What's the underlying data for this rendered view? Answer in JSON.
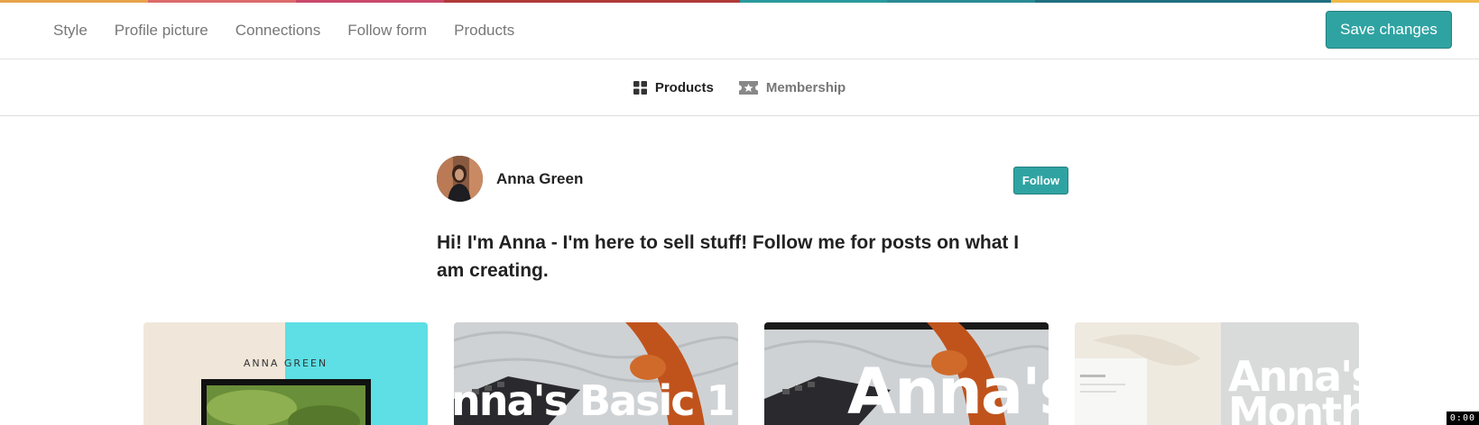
{
  "topbar": {
    "nav": [
      {
        "label": "Style"
      },
      {
        "label": "Profile picture"
      },
      {
        "label": "Connections"
      },
      {
        "label": "Follow form"
      },
      {
        "label": "Products"
      }
    ],
    "save_label": "Save changes"
  },
  "subnav": {
    "tabs": [
      {
        "label": "Products",
        "icon": "grid-icon",
        "active": true
      },
      {
        "label": "Membership",
        "icon": "ticket-star-icon",
        "active": false
      }
    ]
  },
  "profile": {
    "name": "Anna Green",
    "follow_label": "Follow",
    "bio": "Hi! I'm Anna - I'm here to sell stuff! Follow me for posts on what I am creating."
  },
  "products": [
    {
      "brand_text": "ANNA GREEN",
      "overlay_text": ""
    },
    {
      "brand_text": "",
      "overlay_text": "nna's Basic 1"
    },
    {
      "brand_text": "",
      "overlay_text": "Anna's"
    },
    {
      "brand_text": "",
      "overlay_text": "Anna's",
      "overlay_text_2": "Month"
    }
  ],
  "timer": "0:00",
  "colors": {
    "accent": "#2fa3a2",
    "rainbow": [
      "#e8a24c",
      "#dd6b6b",
      "#c9496b",
      "#b03a3a",
      "#2a9a9c",
      "#2b8a95",
      "#1f6f80",
      "#f0b94a"
    ]
  }
}
